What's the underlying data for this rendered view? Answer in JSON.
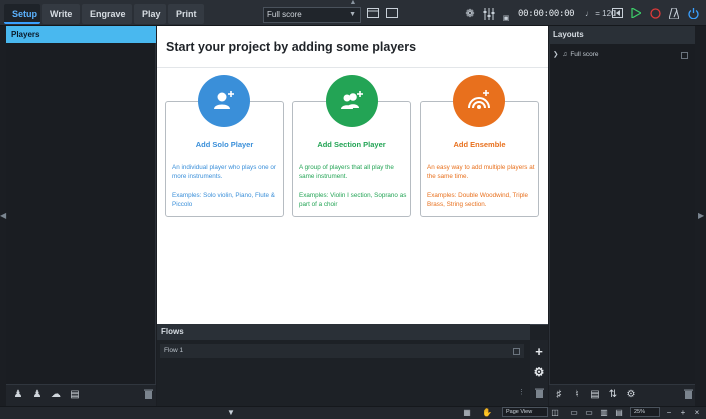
{
  "tabs": [
    {
      "label": "Setup",
      "active": true
    },
    {
      "label": "Write",
      "active": false
    },
    {
      "label": "Engrave",
      "active": false
    },
    {
      "label": "Play",
      "active": false
    },
    {
      "label": "Print",
      "active": false
    }
  ],
  "toolbar": {
    "layout_select": "Full score",
    "time": "00:00:00:00",
    "tempo": "♩ = 120"
  },
  "players_panel": {
    "title": "Players"
  },
  "center": {
    "title": "Start your project by adding some players",
    "cards": [
      {
        "title": "Add Solo Player",
        "description": "An individual player who plays one or more instruments.",
        "examples": "Examples: Solo violin, Piano, Flute & Piccolo",
        "color": "#3a8fd9"
      },
      {
        "title": "Add Section Player",
        "description": "A group of players that all play the same instrument.",
        "examples": "Examples: Violin I section, Soprano as part of a choir",
        "color": "#23a455"
      },
      {
        "title": "Add Ensemble",
        "description": "An easy way to add multiple players at the same time.",
        "examples": "Examples: Double Woodwind, Triple Brass, String section.",
        "color": "#e8701d"
      }
    ]
  },
  "flows": {
    "title": "Flows",
    "items": [
      "Flow 1"
    ]
  },
  "layouts": {
    "title": "Layouts",
    "items": [
      "Full score"
    ]
  },
  "statusbar": {
    "view": "Page View",
    "zoom": "25%"
  },
  "colors": {
    "accent": "#3aa0ff",
    "players_header": "#49b8ef",
    "solo": "#3a8fd9",
    "section": "#23a455",
    "ensemble": "#e8701d"
  }
}
